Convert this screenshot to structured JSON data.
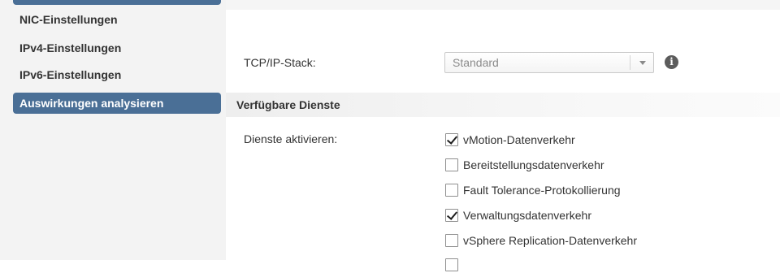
{
  "sidebar": {
    "items": [
      {
        "label": "NIC-Einstellungen",
        "selected": false
      },
      {
        "label": "IPv4-Einstellungen",
        "selected": false
      },
      {
        "label": "IPv6-Einstellungen",
        "selected": false
      },
      {
        "label": "Auswirkungen analysieren",
        "selected": true
      }
    ],
    "selected_color": "#4a6f96"
  },
  "main": {
    "tcpip_stack": {
      "label": "TCP/IP-Stack:",
      "value": "Standard",
      "info_icon": "info-icon"
    },
    "section": {
      "title": "Verfügbare Dienste"
    },
    "services": {
      "label": "Dienste aktivieren:",
      "items": [
        {
          "label": "vMotion-Datenverkehr",
          "checked": true
        },
        {
          "label": "Bereitstellungsdatenverkehr",
          "checked": false
        },
        {
          "label": "Fault Tolerance-Protokollierung",
          "checked": false
        },
        {
          "label": "Verwaltungsdatenverkehr",
          "checked": true
        },
        {
          "label": "vSphere Replication-Datenverkehr",
          "checked": false
        }
      ]
    }
  }
}
